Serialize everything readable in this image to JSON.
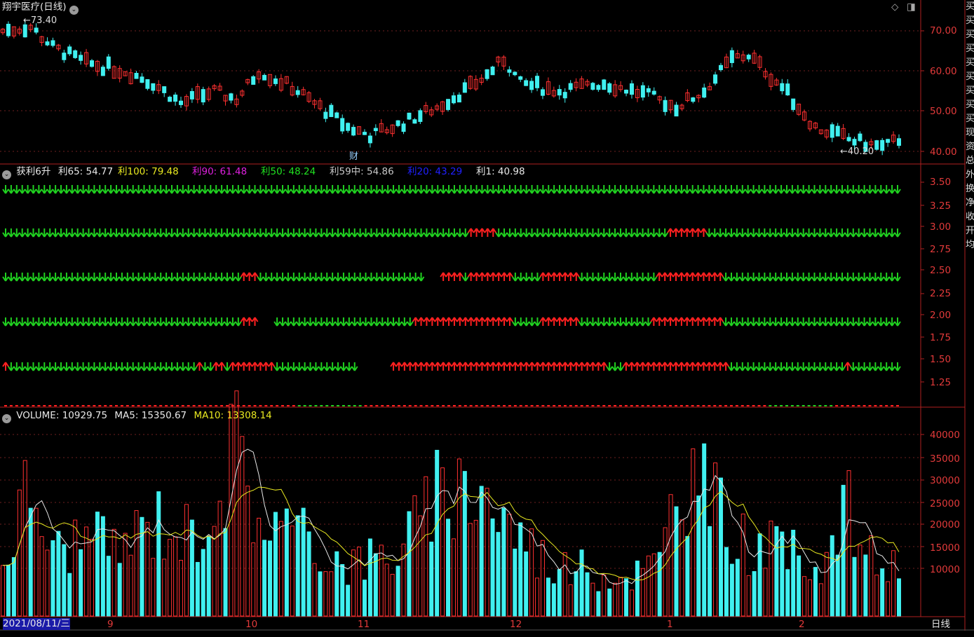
{
  "header": {
    "title": "翔宇医疗(日线)",
    "high_label": "73.40",
    "low_label": "40.20",
    "cai_badge": "财",
    "price_ticks": [
      "70.00",
      "60.00",
      "50.00",
      "40.00"
    ]
  },
  "indicator_panel": {
    "name": "获利6升",
    "values": [
      {
        "label": "利65:",
        "value": "54.77",
        "color": "#e8e8e8"
      },
      {
        "label": "利100:",
        "value": "79.48",
        "color": "#e8e820"
      },
      {
        "label": "利90:",
        "value": "61.48",
        "color": "#e020e0"
      },
      {
        "label": "利50:",
        "value": "48.24",
        "color": "#20e020"
      },
      {
        "label": "利59中:",
        "value": "54.86",
        "color": "#c8c8c8"
      },
      {
        "label": "利20:",
        "value": "43.29",
        "color": "#2020ff"
      },
      {
        "label": "利1:",
        "value": "40.98",
        "color": "#e8e8e8"
      }
    ],
    "ticks": [
      "3.50",
      "3.25",
      "3.00",
      "2.75",
      "2.50",
      "2.25",
      "2.00",
      "1.75",
      "1.50",
      "1.25"
    ]
  },
  "volume_panel": {
    "name": "VOLUME:",
    "volume": "10929.75",
    "ma5_label": "MA5:",
    "ma5": "15350.67",
    "ma10_label": "MA10:",
    "ma10": "13308.14",
    "ticks": [
      "40000",
      "35000",
      "30000",
      "25000",
      "20000",
      "15000",
      "10000"
    ]
  },
  "date_axis": {
    "current_date": "2021/08/11/三",
    "months": [
      "9",
      "10",
      "11",
      "12",
      "1",
      "2"
    ],
    "period": "日线"
  },
  "colors": {
    "up": "#ff3030",
    "down": "#40f0f0",
    "grid": "#b02020",
    "arrow_up": "#ff2020",
    "arrow_down": "#20d020"
  },
  "side_strip": "买买买买买买买买买现资总外换净收开均"
}
